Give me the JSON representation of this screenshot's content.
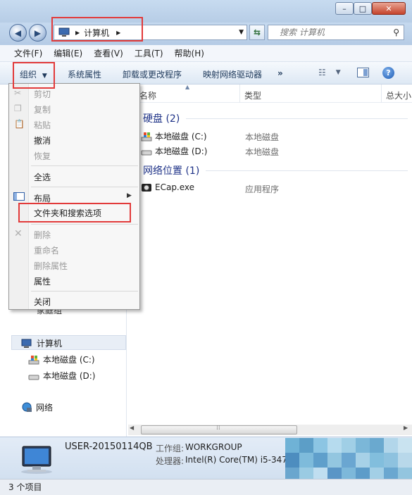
{
  "toolbar_title_icons": {
    "minimize": "minimize-icon",
    "maximize": "maximize-icon",
    "close": "close-icon"
  },
  "address": {
    "crumb": "计算机"
  },
  "search": {
    "placeholder": "搜索 计算机"
  },
  "menubar": {
    "file": "文件(F)",
    "edit": "编辑(E)",
    "view": "查看(V)",
    "tools": "工具(T)",
    "help": "帮助(H)"
  },
  "toolbar": {
    "organize": "组织",
    "system_properties": "系统属性",
    "uninstall": "卸载或更改程序",
    "map_drive": "映射网络驱动器",
    "more": "»"
  },
  "columns": {
    "name": "名称",
    "type": "类型",
    "total": "总大小"
  },
  "groups": {
    "hard_disks": "硬盘 (2)",
    "network": "网络位置 (1)"
  },
  "items": [
    {
      "name": "本地磁盘 (C:)",
      "type": "本地磁盘"
    },
    {
      "name": "本地磁盘 (D:)",
      "type": "本地磁盘"
    },
    {
      "name": "ECap.exe",
      "type": "应用程序"
    }
  ],
  "navpane": {
    "homegroup_partial": "家庭组",
    "computer": "计算机",
    "drive_c": "本地磁盘 (C:)",
    "drive_d": "本地磁盘 (D:)",
    "network": "网络"
  },
  "dropdown": {
    "cut": "剪切",
    "copy": "复制",
    "paste": "粘贴",
    "undo": "撤消",
    "redo": "恢复",
    "select_all": "全选",
    "layout": "布局",
    "folder_options": "文件夹和搜索选项",
    "delete": "删除",
    "rename": "重命名",
    "remove_props": "删除属性",
    "properties": "属性",
    "close": "关闭"
  },
  "details": {
    "computer_name": "USER-20150114QB",
    "workgroup_label": "工作组:",
    "workgroup": "WORKGROUP",
    "processor_label": "处理器:",
    "processor": "Intel(R) Core(TM) i5-347"
  },
  "status": {
    "count": "3 个项目"
  },
  "colors": {
    "highlight": "#e23a3a",
    "group_title": "#1e3287",
    "toolbar_text": "#1e395b"
  }
}
